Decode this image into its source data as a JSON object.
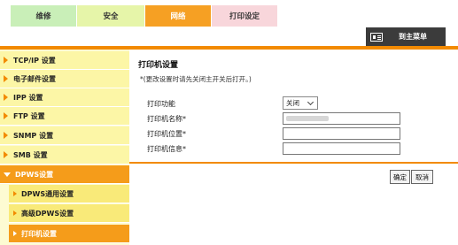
{
  "tabs": [
    {
      "label": "维修"
    },
    {
      "label": "安全"
    },
    {
      "label": "网络"
    },
    {
      "label": "打印设定"
    }
  ],
  "header": {
    "main_menu_label": "到主菜单"
  },
  "sidebar": {
    "items": [
      {
        "label": "TCP/IP 设置"
      },
      {
        "label": "电子邮件设置"
      },
      {
        "label": "IPP 设置"
      },
      {
        "label": "FTP 设置"
      },
      {
        "label": "SNMP 设置"
      },
      {
        "label": "SMB 设置"
      },
      {
        "label": "DPWS设置"
      }
    ],
    "subitems": [
      {
        "label": "DPWS通用设置"
      },
      {
        "label": "高级DPWS设置"
      },
      {
        "label": "打印机设置"
      }
    ]
  },
  "main": {
    "title": "打印机设置",
    "note": "*(更改设置时请先关闭主开关后打开。)",
    "fields": {
      "print_function_label": "打印功能",
      "print_function_value": "关闭",
      "printer_name_label": "打印机名称*",
      "printer_location_label": "打印机位置*",
      "printer_info_label": "打印机信息*"
    },
    "buttons": {
      "ok": "确定",
      "cancel": "取消"
    }
  },
  "colors": {
    "accent": "#f28a00",
    "sidebar_item": "#fcf6a6",
    "sidebar_sub": "#f9ea79",
    "active": "#f59c1a"
  }
}
